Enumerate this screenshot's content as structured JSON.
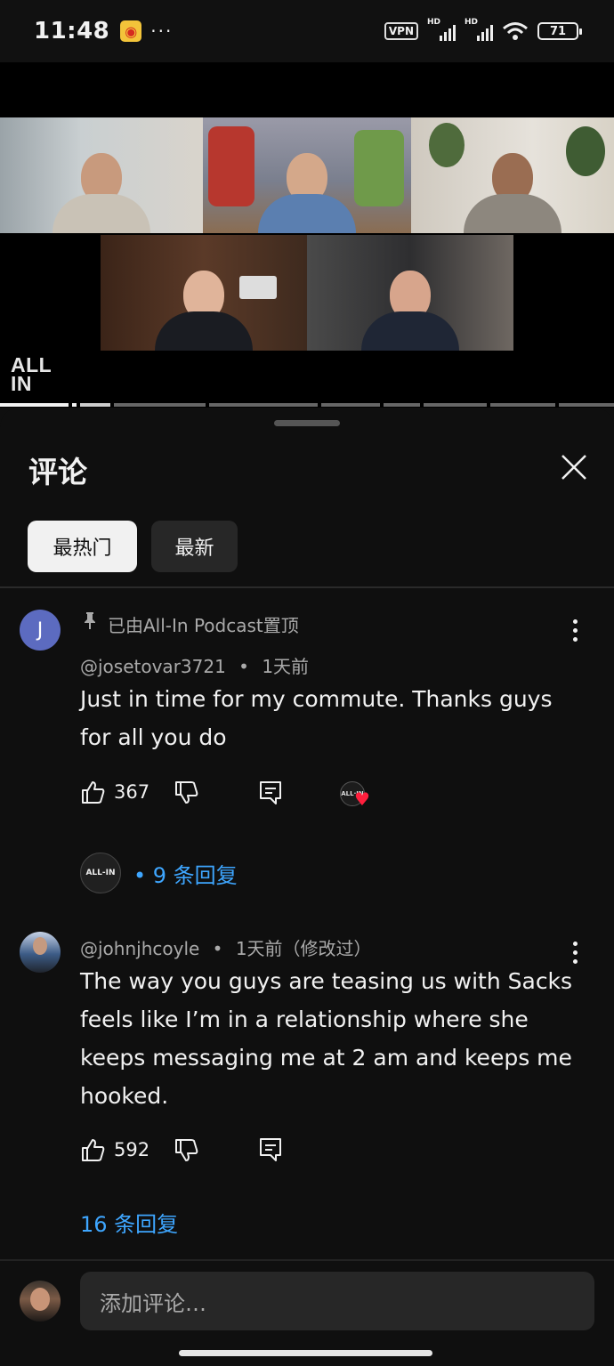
{
  "status_bar": {
    "time": "11:48",
    "vpn": "VPN",
    "battery": "71"
  },
  "video": {
    "brand_line1": "ALL",
    "brand_line2": "IN"
  },
  "comments_panel": {
    "title": "评论",
    "filters": [
      {
        "label": "最热门",
        "active": true
      },
      {
        "label": "最新",
        "active": false
      }
    ]
  },
  "comments": [
    {
      "avatar_letter": "J",
      "avatar_color": "#5c6bc0",
      "pinned_text": "已由All-In Podcast置顶",
      "author": "@josetovar3721",
      "time": "1天前",
      "text": "Just in time for my commute. Thanks guys for all you do",
      "likes": "367",
      "replies_label": "• 9 条回复"
    },
    {
      "author": "@johnjhcoyle",
      "time": "1天前（修改过）",
      "text": "The way you guys are teasing us with Sacks feels like I’m in a relationship where she keeps messaging me at 2 am and keeps me hooked.",
      "likes": "592",
      "replies_label": "16 条回复"
    }
  ],
  "composer": {
    "placeholder": "添加评论…"
  },
  "colors": {
    "link": "#3ea6ff",
    "background": "#0f0f0f",
    "chip_inactive": "#272727"
  }
}
